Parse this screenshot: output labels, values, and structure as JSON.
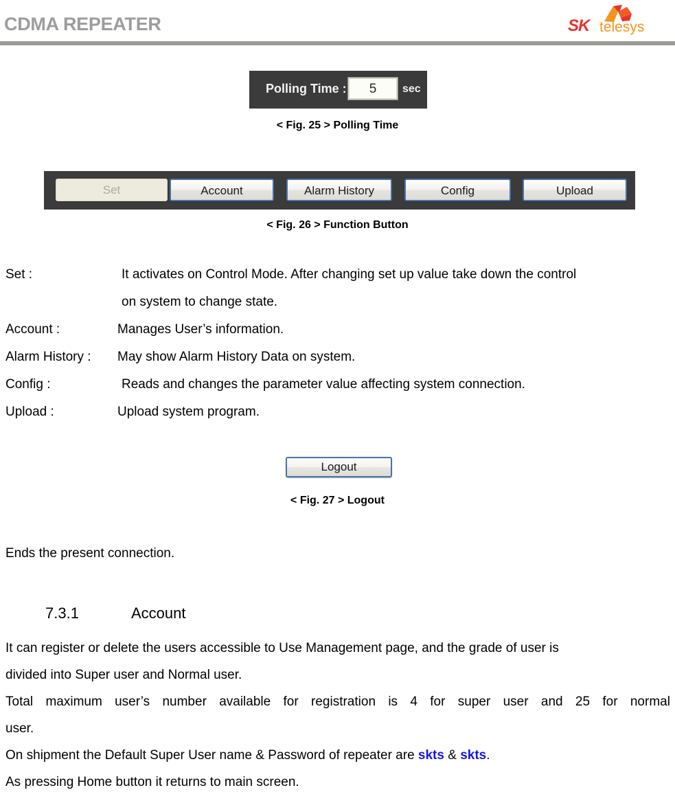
{
  "header": {
    "title": "CDMA REPEATER",
    "logo": {
      "sk": "SK",
      "telesys": "telesys"
    }
  },
  "figure_25": {
    "caption": "< Fig. 25 > Polling Time",
    "panel": {
      "label": "Polling Time :",
      "value": "5",
      "unit": "sec"
    }
  },
  "figure_26": {
    "caption": "< Fig. 26 > Function Button",
    "buttons": [
      {
        "label": "Set",
        "state": "disabled"
      },
      {
        "label": "Account",
        "state": "enabled"
      },
      {
        "label": "Alarm History",
        "state": "enabled"
      },
      {
        "label": "Config",
        "state": "enabled"
      },
      {
        "label": "Upload",
        "state": "enabled"
      }
    ]
  },
  "descriptions": [
    {
      "term": "Set :",
      "definition": "It activates on Control Mode. After changing set up value take down the control"
    },
    {
      "term": "",
      "definition": "on system to change state."
    },
    {
      "term": "Account  :",
      "definition": "Manages User’s information."
    },
    {
      "term": "Alarm History :",
      "definition": "May show Alarm History Data on system."
    },
    {
      "term": "Config :",
      "definition": "Reads and changes the parameter value affecting system connection."
    },
    {
      "term": "Upload :",
      "definition": "Upload system program."
    }
  ],
  "figure_27": {
    "caption": "< Fig. 27 > Logout",
    "button_label": "Logout",
    "description": "Ends the present connection."
  },
  "section": {
    "number": "7.3.1",
    "title": "Account"
  },
  "account_paragraph": {
    "line1": "It can register or delete the users accessible to Use Management page, and the grade of user is",
    "line2": "divided into Super user and Normal user.",
    "line3_words": [
      "Total",
      "maximum",
      "user’s",
      "number",
      "available",
      "for",
      "registration",
      "is",
      "4",
      "for",
      "super",
      "user",
      "and",
      "25",
      "for",
      "normal"
    ],
    "line4": "user.",
    "line5_pre": "On shipment the Default Super User name & Password of repeater are ",
    "line5_user": "skts",
    "line5_mid": " & ",
    "line5_pass": "skts",
    "line5_post": ".",
    "line6": "As pressing Home button it returns to main screen."
  },
  "colors": {
    "header_title": "#9d9d9d",
    "header_rule": "#9a9a96",
    "panel_background": "#3b3b3b",
    "button_border": "#4a72a8",
    "highlight_blue": "#1414f0",
    "logo_sk_red": "#e8332a",
    "logo_telesys_orange": "#f7941e"
  }
}
